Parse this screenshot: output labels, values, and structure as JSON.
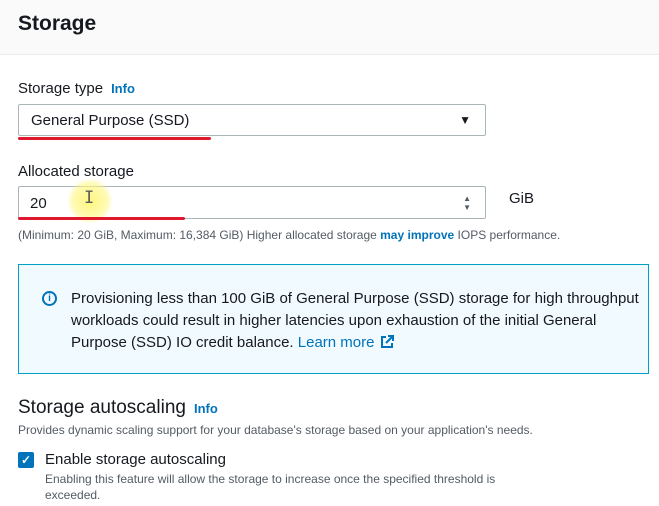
{
  "header": {
    "title": "Storage"
  },
  "storage_type": {
    "label": "Storage type",
    "info": "Info",
    "value": "General Purpose (SSD)"
  },
  "allocated_storage": {
    "label": "Allocated storage",
    "value": "20",
    "unit": "GiB",
    "hint_prefix": "(Minimum: 20 GiB, Maximum: 16,384 GiB) Higher allocated storage ",
    "hint_strong": "may improve",
    "hint_suffix": " IOPS performance."
  },
  "alert": {
    "text": "Provisioning less than 100 GiB of General Purpose (SSD) storage for high throughput workloads could result in higher latencies upon exhaustion of the initial General Purpose (SSD) IO credit balance. ",
    "link": "Learn more"
  },
  "autoscaling": {
    "title": "Storage autoscaling",
    "info": "Info",
    "description": "Provides dynamic scaling support for your database's storage based on your application's needs.",
    "checkbox_label": "Enable storage autoscaling",
    "checkbox_checked": true,
    "checkbox_description": "Enabling this feature will allow the storage to increase once the specified threshold is exceeded."
  },
  "colors": {
    "accent": "#0073bb",
    "annotation_red": "#e0182d",
    "alert_border": "#00a1c9",
    "alert_bg": "#f1faff"
  }
}
